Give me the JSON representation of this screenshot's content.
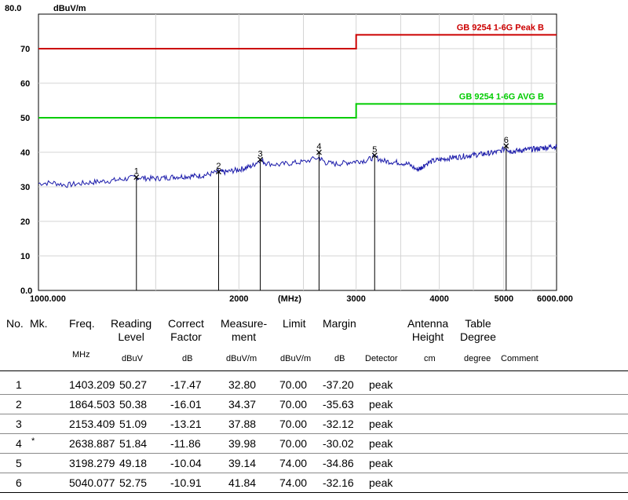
{
  "chart_data": {
    "type": "line",
    "y_max_label": "80.0",
    "y_unit": "dBuV/m",
    "x_unit": "(MHz)",
    "x_scale": "log",
    "xlim": [
      1000,
      6000
    ],
    "ylim": [
      0,
      80
    ],
    "x_ticks": [
      {
        "value": 1000,
        "label": "1000.000"
      },
      {
        "value": 2000,
        "label": "2000"
      },
      {
        "value": 3000,
        "label": "3000"
      },
      {
        "value": 4000,
        "label": "4000"
      },
      {
        "value": 5000,
        "label": "5000"
      },
      {
        "value": 6000,
        "label": "6000.000"
      }
    ],
    "y_ticks": [
      {
        "value": 0,
        "label": "0.0"
      },
      {
        "value": 10,
        "label": "10"
      },
      {
        "value": 20,
        "label": "20"
      },
      {
        "value": 30,
        "label": "30"
      },
      {
        "value": 40,
        "label": "40"
      },
      {
        "value": 50,
        "label": "50"
      },
      {
        "value": 60,
        "label": "60"
      },
      {
        "value": 70,
        "label": "70"
      }
    ],
    "limit_lines": [
      {
        "name": "GB 9254 1-6G Peak B",
        "color": "#cc0000",
        "steps": [
          [
            1000,
            70
          ],
          [
            3000,
            70
          ],
          [
            3000,
            74
          ],
          [
            6000,
            74
          ]
        ]
      },
      {
        "name": "GB 9254 1-6G AVG B",
        "color": "#00cc00",
        "steps": [
          [
            1000,
            50
          ],
          [
            3000,
            50
          ],
          [
            3000,
            54
          ],
          [
            6000,
            54
          ]
        ]
      }
    ],
    "trace": {
      "color": "#1a1aaa",
      "points": [
        [
          1000,
          31.0
        ],
        [
          1050,
          31.2
        ],
        [
          1100,
          30.5
        ],
        [
          1150,
          30.9
        ],
        [
          1200,
          31.3
        ],
        [
          1250,
          31.6
        ],
        [
          1300,
          31.9
        ],
        [
          1350,
          32.3
        ],
        [
          1403,
          32.8
        ],
        [
          1450,
          32.5
        ],
        [
          1500,
          32.4
        ],
        [
          1550,
          32.6
        ],
        [
          1600,
          32.9
        ],
        [
          1650,
          33.0
        ],
        [
          1700,
          33.1
        ],
        [
          1750,
          33.2
        ],
        [
          1800,
          33.6
        ],
        [
          1864,
          34.4
        ],
        [
          1900,
          34.2
        ],
        [
          1950,
          34.6
        ],
        [
          2000,
          35.0
        ],
        [
          2050,
          35.5
        ],
        [
          2100,
          36.2
        ],
        [
          2153,
          37.9
        ],
        [
          2200,
          36.8
        ],
        [
          2300,
          36.4
        ],
        [
          2400,
          36.9
        ],
        [
          2500,
          37.2
        ],
        [
          2638,
          38.5
        ],
        [
          2700,
          37.0
        ],
        [
          2800,
          36.6
        ],
        [
          2900,
          37.0
        ],
        [
          3000,
          37.4
        ],
        [
          3100,
          37.6
        ],
        [
          3198,
          38.6
        ],
        [
          3300,
          37.5
        ],
        [
          3400,
          37.2
        ],
        [
          3500,
          37.0
        ],
        [
          3600,
          36.5
        ],
        [
          3700,
          35.0
        ],
        [
          3750,
          35.4
        ],
        [
          3800,
          36.4
        ],
        [
          3900,
          37.4
        ],
        [
          4000,
          37.8
        ],
        [
          4100,
          38.2
        ],
        [
          4200,
          38.5
        ],
        [
          4300,
          38.7
        ],
        [
          4400,
          39.0
        ],
        [
          4500,
          39.2
        ],
        [
          4600,
          39.4
        ],
        [
          4700,
          39.6
        ],
        [
          4800,
          39.8
        ],
        [
          4900,
          40.1
        ],
        [
          5040,
          41.2
        ],
        [
          5100,
          40.4
        ],
        [
          5200,
          40.3
        ],
        [
          5300,
          40.6
        ],
        [
          5400,
          40.7
        ],
        [
          5500,
          40.9
        ],
        [
          5600,
          41.0
        ],
        [
          5700,
          41.2
        ],
        [
          5800,
          41.4
        ],
        [
          5900,
          41.7
        ],
        [
          6000,
          41.6
        ]
      ]
    },
    "markers": [
      {
        "label": "1",
        "freq": 1403.209,
        "level": 32.8
      },
      {
        "label": "2",
        "freq": 1864.503,
        "level": 34.37
      },
      {
        "label": "3",
        "freq": 2153.409,
        "level": 37.88
      },
      {
        "label": "4",
        "freq": 2638.887,
        "level": 39.98
      },
      {
        "label": "5",
        "freq": 3198.279,
        "level": 39.14
      },
      {
        "label": "6",
        "freq": 5040.077,
        "level": 41.84
      }
    ]
  },
  "table": {
    "headers": {
      "no": "No.",
      "mk": "Mk.",
      "freq": "Freq.",
      "reading": "Reading\nLevel",
      "correct": "Correct\nFactor",
      "measure": "Measure-\nment",
      "limit": "Limit",
      "margin": "Margin",
      "antenna": "Antenna\nHeight",
      "table_deg": "Table\nDegree"
    },
    "units": {
      "freq": "MHz",
      "reading": "dBuV",
      "correct": "dB",
      "measure": "dBuV/m",
      "limit": "dBuV/m",
      "margin": "dB",
      "detector": "Detector",
      "antenna": "cm",
      "table_deg": "degree",
      "comment": "Comment"
    },
    "rows": [
      {
        "no": "1",
        "mk": "",
        "freq": "1403.209",
        "reading": "50.27",
        "correct": "-17.47",
        "measure": "32.80",
        "limit": "70.00",
        "margin": "-37.20",
        "detector": "peak"
      },
      {
        "no": "2",
        "mk": "",
        "freq": "1864.503",
        "reading": "50.38",
        "correct": "-16.01",
        "measure": "34.37",
        "limit": "70.00",
        "margin": "-35.63",
        "detector": "peak"
      },
      {
        "no": "3",
        "mk": "",
        "freq": "2153.409",
        "reading": "51.09",
        "correct": "-13.21",
        "measure": "37.88",
        "limit": "70.00",
        "margin": "-32.12",
        "detector": "peak"
      },
      {
        "no": "4",
        "mk": "*",
        "freq": "2638.887",
        "reading": "51.84",
        "correct": "-11.86",
        "measure": "39.98",
        "limit": "70.00",
        "margin": "-30.02",
        "detector": "peak"
      },
      {
        "no": "5",
        "mk": "",
        "freq": "3198.279",
        "reading": "49.18",
        "correct": "-10.04",
        "measure": "39.14",
        "limit": "74.00",
        "margin": "-34.86",
        "detector": "peak"
      },
      {
        "no": "6",
        "mk": "",
        "freq": "5040.077",
        "reading": "52.75",
        "correct": "-10.91",
        "measure": "41.84",
        "limit": "74.00",
        "margin": "-32.16",
        "detector": "peak"
      }
    ]
  }
}
